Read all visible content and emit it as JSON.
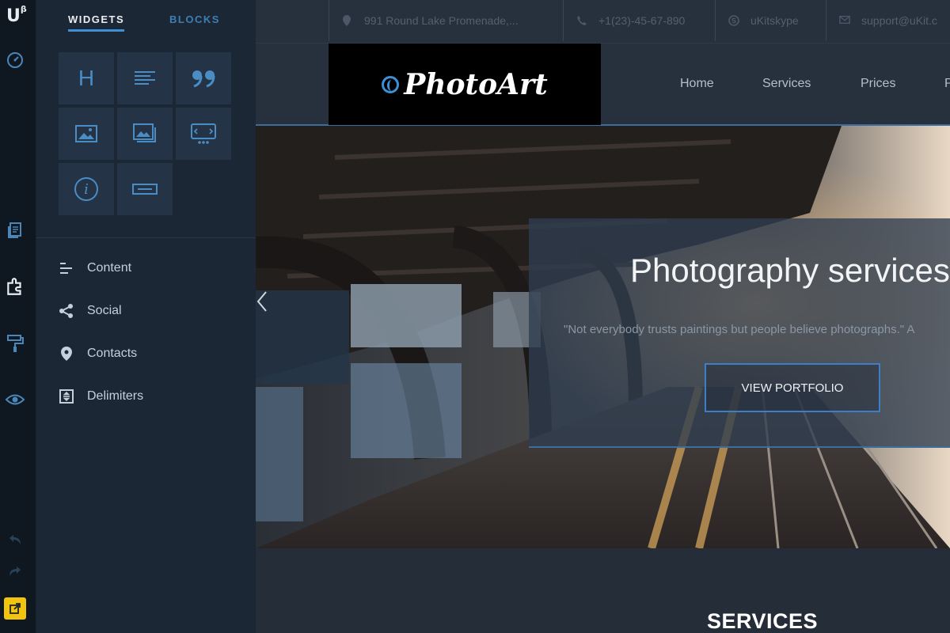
{
  "rail": {
    "logo_letter": "U",
    "logo_super": "β",
    "icons": [
      "dashboard-icon",
      "pages-icon",
      "widgets-icon",
      "design-icon",
      "preview-icon",
      "undo-icon",
      "redo-icon",
      "publish-icon"
    ]
  },
  "panel": {
    "tabs": [
      {
        "label": "WIDGETS",
        "active": true
      },
      {
        "label": "BLOCKS",
        "active": false
      }
    ],
    "widgets": [
      {
        "icon": "heading-icon",
        "glyph": "H"
      },
      {
        "icon": "text-icon"
      },
      {
        "icon": "quote-icon",
        "glyph": "99"
      },
      {
        "icon": "image-icon"
      },
      {
        "icon": "gallery-icon"
      },
      {
        "icon": "slider-icon"
      },
      {
        "icon": "info-icon",
        "glyph": "i"
      },
      {
        "icon": "button-icon"
      }
    ],
    "categories": [
      {
        "label": "Content",
        "icon": "content-icon"
      },
      {
        "label": "Social",
        "icon": "share-icon"
      },
      {
        "label": "Contacts",
        "icon": "location-pin-icon"
      },
      {
        "label": "Delimiters",
        "icon": "delimiter-icon"
      }
    ]
  },
  "site": {
    "topbar": [
      {
        "text": "991 Round Lake Promenade,...",
        "icon": "location-pin-icon"
      },
      {
        "text": "+1(23)-45-67-890",
        "icon": "phone-icon"
      },
      {
        "text": "uKitskype",
        "icon": "skype-icon"
      },
      {
        "text": "support@uKit.c",
        "icon": "mail-icon"
      }
    ],
    "logo": "PhotoArt",
    "nav": [
      "Home",
      "Services",
      "Prices",
      "P"
    ],
    "hero": {
      "title": "Photography services",
      "quote": "\"Not everybody trusts paintings but people believe photographs.\" A",
      "cta": "VIEW PORTFOLIO"
    },
    "section_heading": "SERVICES"
  },
  "colors": {
    "accent": "#3d8fd6",
    "publish": "#f1c40f",
    "panel_bg": "#1c2735",
    "rail_bg": "#0f1721"
  }
}
